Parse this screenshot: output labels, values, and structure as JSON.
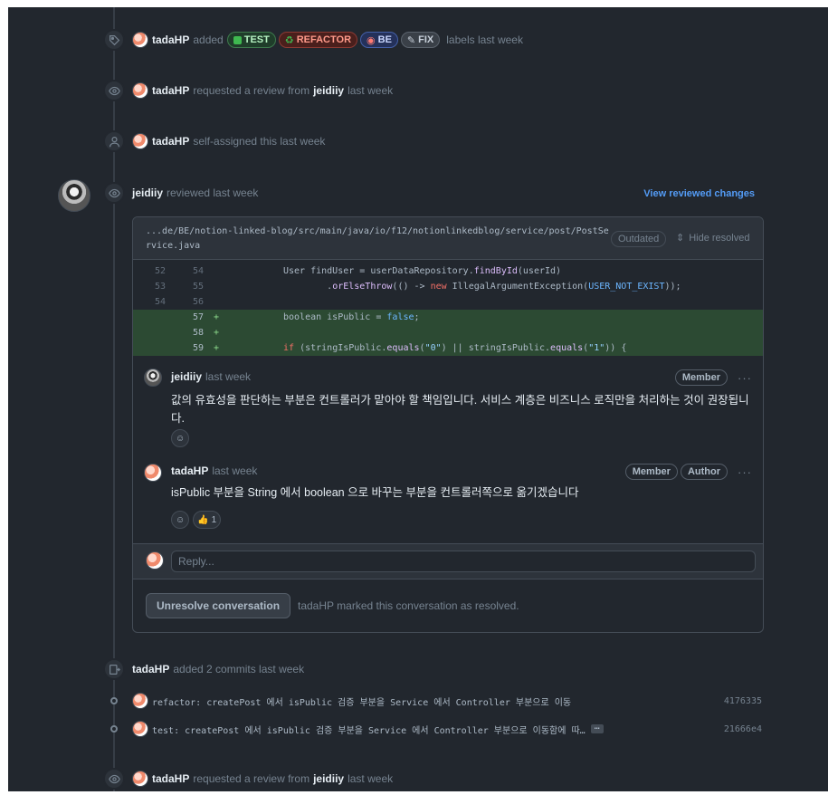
{
  "events": {
    "labels_event": {
      "user": "tadaHP",
      "verb": "added",
      "labels": [
        "TEST",
        "REFACTOR",
        "BE",
        "FIX"
      ],
      "suffix": "labels last week"
    },
    "review_request_1": {
      "user": "tadaHP",
      "text": "requested a review from",
      "target": "jeidiiy",
      "time": "last week"
    },
    "self_assign": {
      "user": "tadaHP",
      "text": "self-assigned this last week"
    },
    "review": {
      "user": "jeidiiy",
      "text": "reviewed last week",
      "link": "View reviewed changes"
    },
    "commits_event": {
      "user": "tadaHP",
      "text": "added 2 commits last week"
    },
    "review_request_2": {
      "user": "tadaHP",
      "text": "requested a review from",
      "target": "jeidiiy",
      "time": "last week"
    }
  },
  "review_thread": {
    "file_path": "...de/BE/notion-linked-blog/src/main/java/io/f12/notionlinkedblog/service/post/PostService.java",
    "outdated": "Outdated",
    "hide_resolved": "Hide resolved",
    "diff": [
      {
        "old": "52",
        "new": "54",
        "sign": "",
        "added": false
      },
      {
        "old": "53",
        "new": "55",
        "sign": "",
        "added": false
      },
      {
        "old": "54",
        "new": "56",
        "sign": "",
        "added": false
      },
      {
        "old": "",
        "new": "57",
        "sign": "+",
        "added": true
      },
      {
        "old": "",
        "new": "58",
        "sign": "+",
        "added": true
      },
      {
        "old": "",
        "new": "59",
        "sign": "+",
        "added": true
      }
    ],
    "code": {
      "l1_a": "User findUser = userDataRepository.",
      "l1_fn": "findById",
      "l1_b": "(userId)",
      "l2_a": "        .",
      "l2_fn": "orElseThrow",
      "l2_b": "(() -> ",
      "l2_kw": "new",
      "l2_c": " IllegalArgumentException(",
      "l2_const": "USER_NOT_EXIST",
      "l2_d": "));",
      "l4_a": "boolean isPublic = ",
      "l4_kw": "false",
      "l4_b": ";",
      "l6_kw": "if",
      "l6_a": " (stringIsPublic.",
      "l6_fn1": "equals",
      "l6_b": "(",
      "l6_str1": "\"0\"",
      "l6_c": ") || stringIsPublic.",
      "l6_fn2": "equals",
      "l6_d": "(",
      "l6_str2": "\"1\"",
      "l6_e": ")) {"
    },
    "comments": [
      {
        "author": "jeidiiy",
        "time": "last week",
        "badges": [
          "Member"
        ],
        "body": "값의 유효성을 판단하는 부분은 컨트롤러가 맡아야 할 책임입니다. 서비스 계층은 비즈니스 로직만을 처리하는 것이 권장됩니다."
      },
      {
        "author": "tadaHP",
        "time": "last week",
        "badges": [
          "Member",
          "Author"
        ],
        "body": "isPublic 부분을 String 에서 boolean 으로 바꾸는 부분을 컨트롤러쪽으로 옮기겠습니다",
        "thumbs_up_count": "1"
      }
    ],
    "reply_placeholder": "Reply...",
    "unresolve_button": "Unresolve conversation",
    "resolved_user": "tadaHP",
    "resolved_text": "marked this conversation as resolved."
  },
  "commits": [
    {
      "message": "refactor: createPost 에서 isPublic 검증 부분을 Service 에서 Controller 부분으로 이동",
      "sha": "4176335"
    },
    {
      "message": "test: createPost 에서 isPublic 검증 부분을 Service 에서 Controller 부분으로 이동함에 따…",
      "sha": "21666e4"
    }
  ],
  "colors": {
    "background": "#22272e",
    "accent_link": "#539bf5",
    "diff_added": "#2c4a33"
  }
}
